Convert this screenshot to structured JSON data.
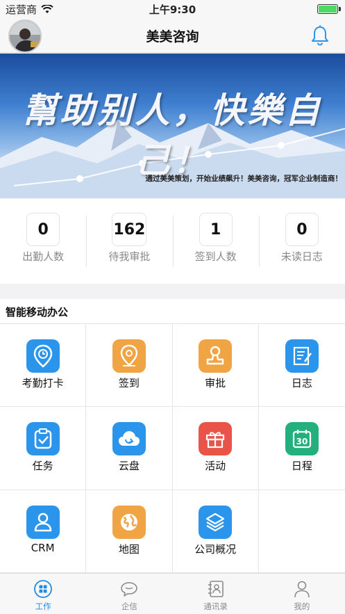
{
  "status_bar": {
    "carrier": "运营商",
    "time": "上午9:30",
    "battery_level": 1.0
  },
  "nav": {
    "title": "美美咨询",
    "avatar_icon": "user-photo-avatar",
    "bell_icon": "bell-icon"
  },
  "banner": {
    "slogan": "幫助别人，快樂自己！",
    "caption": "通过美美策划，开始业绩飙升！美美咨询，冠军企业制造商！"
  },
  "stats": [
    {
      "value": "0",
      "label": "出勤人数"
    },
    {
      "value": "162",
      "label": "待我审批"
    },
    {
      "value": "1",
      "label": "签到人数"
    },
    {
      "value": "0",
      "label": "未读日志"
    }
  ],
  "section": {
    "title": "智能移动办公"
  },
  "apps": [
    {
      "label": "考勤打卡",
      "icon": "location-clock-icon",
      "color": "#2b95ec"
    },
    {
      "label": "签到",
      "icon": "map-pin-icon",
      "color": "#f0a444"
    },
    {
      "label": "审批",
      "icon": "stamp-icon",
      "color": "#f0a444"
    },
    {
      "label": "日志",
      "icon": "notebook-pen-icon",
      "color": "#2b95ec"
    },
    {
      "label": "任务",
      "icon": "clipboard-check-icon",
      "color": "#2b95ec"
    },
    {
      "label": "云盘",
      "icon": "cloud-sync-icon",
      "color": "#2b95ec"
    },
    {
      "label": "活动",
      "icon": "gift-icon",
      "color": "#ea5448"
    },
    {
      "label": "日程",
      "icon": "calendar-30-icon",
      "color": "#23b07c"
    },
    {
      "label": "CRM",
      "icon": "person-icon",
      "color": "#2b95ec"
    },
    {
      "label": "地图",
      "icon": "globe-icon",
      "color": "#f0a444"
    },
    {
      "label": "公司概况",
      "icon": "layers-icon",
      "color": "#2b95ec"
    }
  ],
  "tabs": [
    {
      "label": "工作",
      "icon": "grid-icon",
      "active": true
    },
    {
      "label": "企信",
      "icon": "chat-bubble-icon",
      "active": false
    },
    {
      "label": "通讯录",
      "icon": "contact-book-icon",
      "active": false
    },
    {
      "label": "我的",
      "icon": "user-icon",
      "active": false
    }
  ],
  "colors": {
    "accent": "#1e8ae6",
    "blue_icon": "#2b95ec",
    "orange_icon": "#f0a444",
    "red_icon": "#ea5448",
    "green_icon": "#23b07c"
  }
}
